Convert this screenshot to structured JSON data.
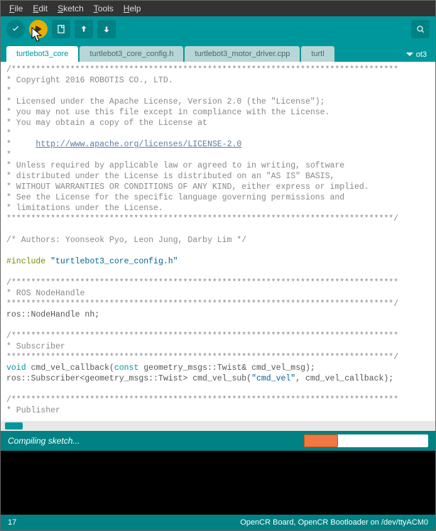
{
  "menu": {
    "file": "File",
    "edit": "Edit",
    "sketch": "Sketch",
    "tools": "Tools",
    "help": "Help"
  },
  "tabs": {
    "t1": "turtlebot3_core",
    "t2": "turtlebot3_core_config.h",
    "t3": "turtlebot3_motor_driver.cpp",
    "t4": "turtl",
    "t5": "ot3"
  },
  "code": {
    "stars1": "/*******************************************************************************",
    "copyright": "* Copyright 2016 ROBOTIS CO., LTD.",
    "star": "*",
    "lic1": "* Licensed under the Apache License, Version 2.0 (the \"License\");",
    "lic2": "* you may not use this file except in compliance with the License.",
    "lic3": "* You may obtain a copy of the License at",
    "lic_url_pre": "*     ",
    "lic_url": "http://www.apache.org/licenses/LICENSE-2.0",
    "lic4": "* Unless required by applicable law or agreed to in writing, software",
    "lic5": "* distributed under the License is distributed on an \"AS IS\" BASIS,",
    "lic6": "* WITHOUT WARRANTIES OR CONDITIONS OF ANY KIND, either express or implied.",
    "lic7": "* See the License for the specific language governing permissions and",
    "lic8": "* limitations under the License.",
    "stars2": "*******************************************************************************/",
    "authors": "/* Authors: Yoonseok Pyo, Leon Jung, Darby Lim */",
    "include_pre": "#include ",
    "include_str": "\"turtlebot3_core_config.h\"",
    "stars3": "/*******************************************************************************",
    "ros_nh": "* ROS NodeHandle",
    "stars4": "*******************************************************************************/",
    "nh_decl": "ros::NodeHandle nh;",
    "stars5": "/*******************************************************************************",
    "sub": "* Subscriber",
    "stars6": "*******************************************************************************/",
    "cb_void": "void",
    "cb_name": " cmd_vel_callback(",
    "cb_const": "const",
    "cb_rest": " geometry_msgs::Twist& cmd_vel_msg);",
    "sub_decl1": "ros::Subscriber<geometry_msgs::Twist> cmd_vel_sub(",
    "sub_str": "\"cmd_vel\"",
    "sub_decl2": ", cmd_vel_callback);",
    "stars7": "/*******************************************************************************",
    "pub": "* Publisher"
  },
  "status": {
    "msg": "Compiling sketch..."
  },
  "footer": {
    "line": "17",
    "board": "OpenCR Board, OpenCR Bootloader on /dev/ttyACM0"
  }
}
